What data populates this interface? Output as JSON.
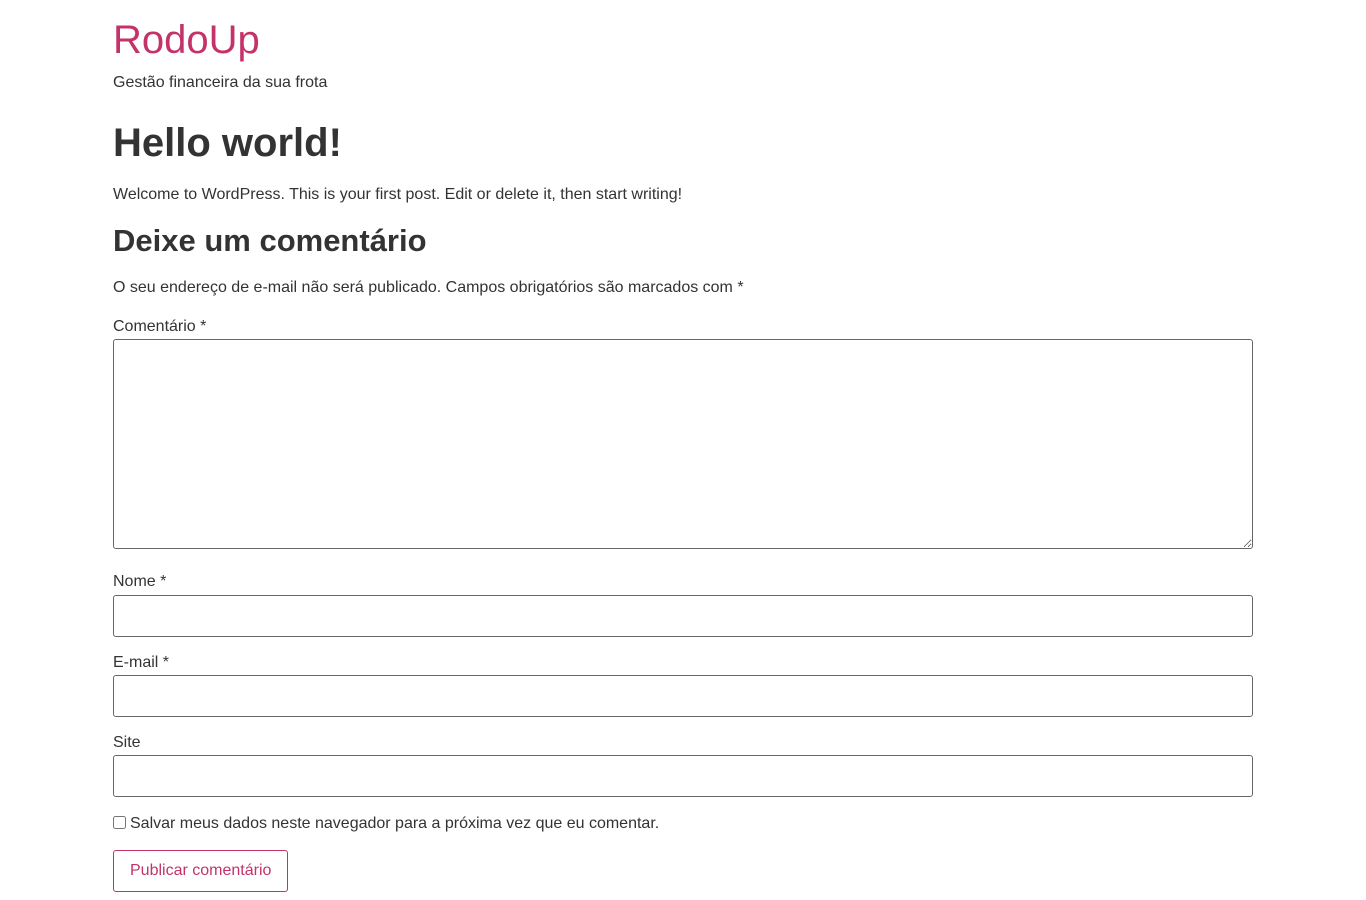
{
  "site": {
    "title": "RodoUp",
    "description": "Gestão financeira da sua frota",
    "brand_color": "#c3336a"
  },
  "post": {
    "title": "Hello world!",
    "body": "Welcome to WordPress. This is your first post. Edit or delete it, then start writing!"
  },
  "comment_form": {
    "heading": "Deixe um comentário",
    "notes_text": "O seu endereço de e-mail não será publicado. Campos obrigatórios são marcados com",
    "required_marker": "*",
    "comment_label": "Comentário",
    "comment_value": "",
    "name_label": "Nome",
    "name_value": "",
    "email_label": "E-mail",
    "email_value": "",
    "site_label": "Site",
    "site_value": "",
    "cookies_label": "Salvar meus dados neste navegador para a próxima vez que eu comentar.",
    "cookies_checked": false,
    "submit_label": "Publicar comentário"
  }
}
